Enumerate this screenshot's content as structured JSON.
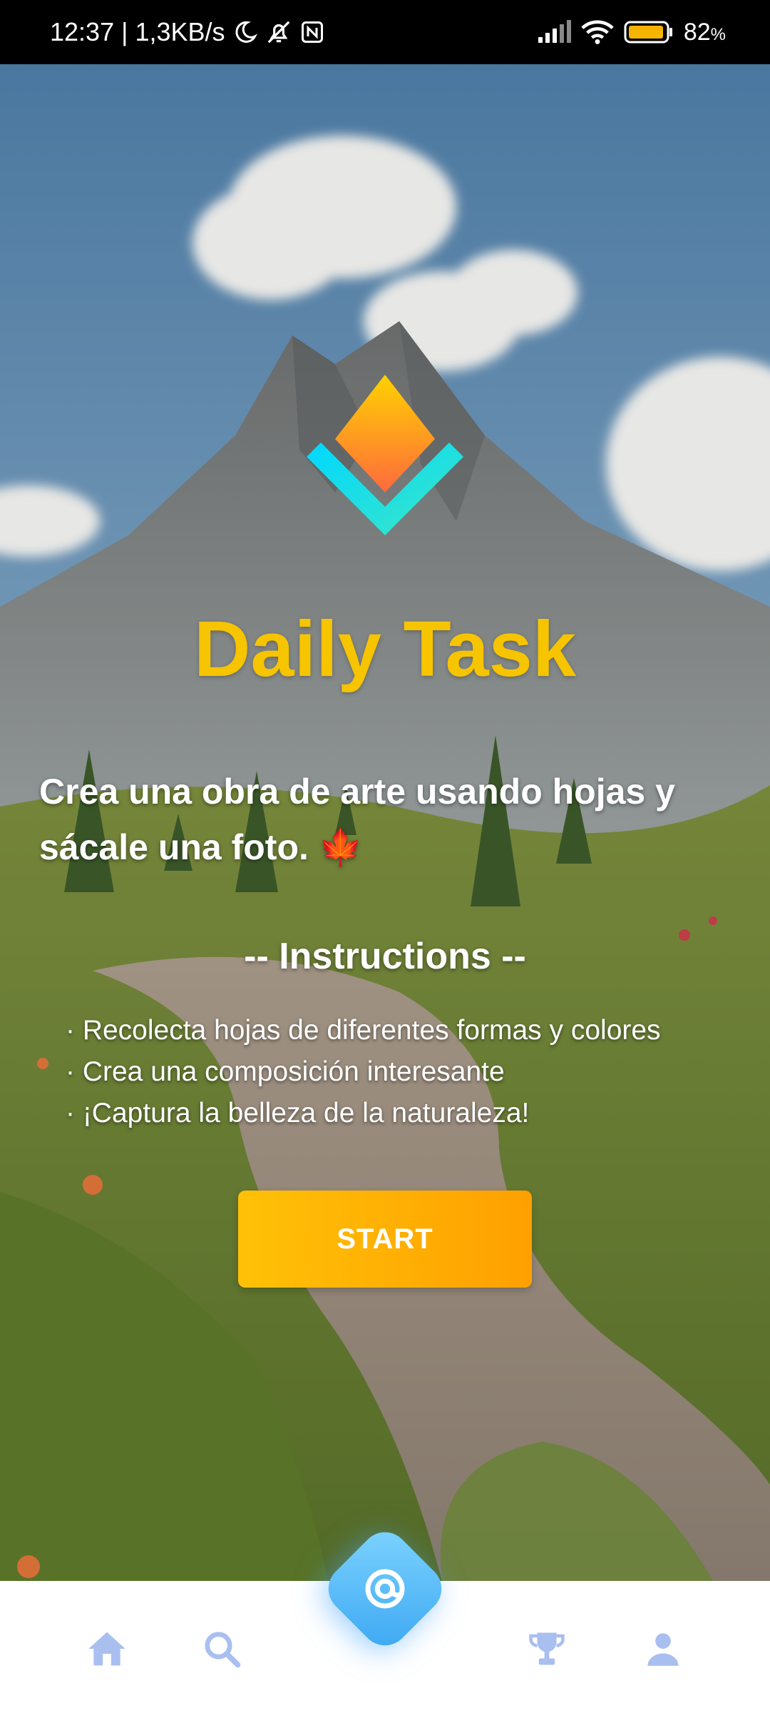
{
  "status_bar": {
    "time_speed": "12:37 | 1,3KB/s",
    "battery_level": "82",
    "battery_unit": "%",
    "icons": [
      "moon-icon",
      "bell-off-icon",
      "nfc-icon",
      "signal-icon",
      "wifi-icon",
      "battery-icon"
    ]
  },
  "app": {
    "title": "Daily Task",
    "task_text": "Crea una obra de arte usando hojas y sácale una foto. 🍁",
    "instructions_heading": "-- Instructions --",
    "instructions": [
      "· Recolecta hojas de diferentes formas y colores",
      "· Crea una composición interesante",
      "· ¡Captura la belleza de la naturaleza!"
    ],
    "start_label": "START"
  },
  "bottom_nav": {
    "items": [
      "home-icon",
      "search-icon",
      "scan-fab-icon",
      "trophy-icon",
      "profile-icon"
    ]
  },
  "colors": {
    "title": "#f7c400",
    "button_start": "#ffc107",
    "button_end": "#ffa000",
    "nav_icon": "#a9bff0",
    "fab_start": "#7fd4ff",
    "fab_end": "#3ba7f2"
  }
}
